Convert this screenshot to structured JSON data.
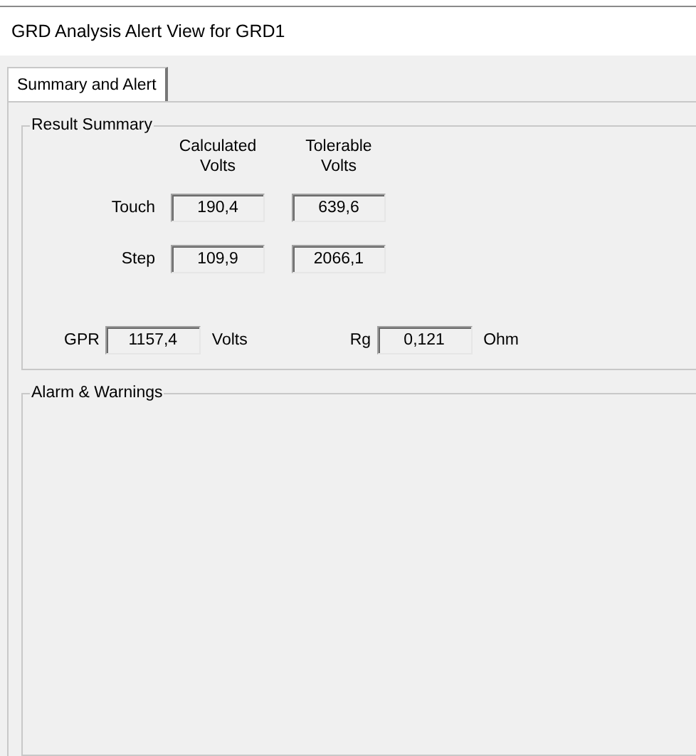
{
  "window": {
    "title": "GRD Analysis Alert View for GRD1"
  },
  "tabs": [
    {
      "label": "Summary and Alert",
      "selected": true
    }
  ],
  "result_summary": {
    "title": "Result Summary",
    "columns": [
      "Calculated\nVolts",
      "Tolerable\nVolts"
    ],
    "rows": [
      {
        "label": "Touch",
        "values": [
          "190,4",
          "639,6"
        ]
      },
      {
        "label": "Step",
        "values": [
          "109,9",
          "2066,1"
        ]
      }
    ],
    "gpr": {
      "label": "GPR",
      "value": "1157,4",
      "unit": "Volts"
    },
    "rg": {
      "label": "Rg",
      "value": "0,121",
      "unit": "Ohm"
    }
  },
  "alarms": {
    "title": "Alarm & Warnings"
  }
}
